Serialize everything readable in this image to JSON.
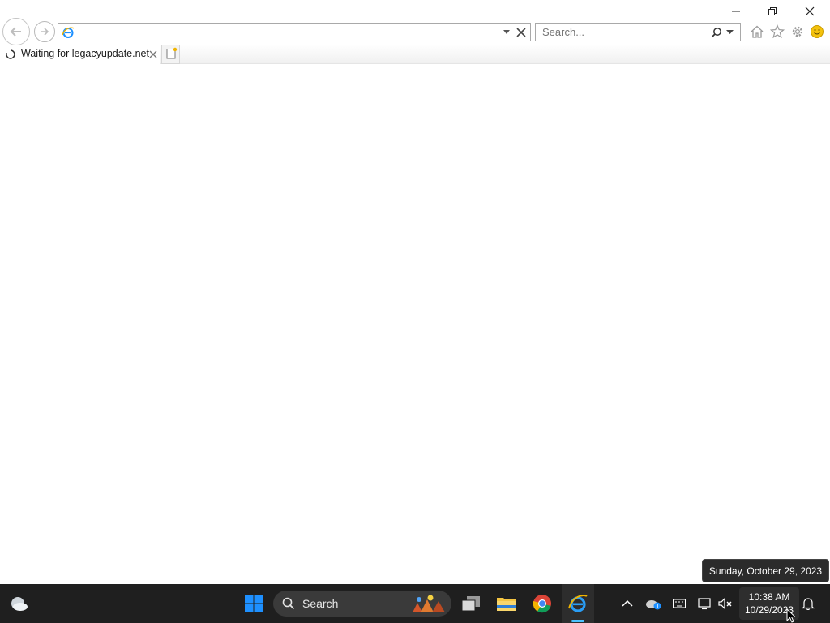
{
  "window": {
    "caption": {
      "minimize_icon": "minimize-icon",
      "restore_icon": "restore-icon",
      "close_icon": "close-icon"
    }
  },
  "navbar": {
    "back_icon": "back-arrow-icon",
    "forward_icon": "forward-arrow-icon",
    "address": {
      "value": "",
      "placeholder": ""
    },
    "search": {
      "placeholder": "Search..."
    },
    "tools": [
      "home-icon",
      "favorites-star-icon",
      "gear-icon",
      "smiley-feedback-icon"
    ]
  },
  "tabs": [
    {
      "label": "Waiting for legacyupdate.net",
      "loading": true
    }
  ],
  "taskbar": {
    "search_label": "Search",
    "clock": {
      "time": "10:38 AM",
      "date": "10/29/2023"
    },
    "tooltip": "Sunday, October 29, 2023",
    "colors": {
      "accent": "#0078d4",
      "taskbar_bg": "#1f1f1f"
    }
  }
}
